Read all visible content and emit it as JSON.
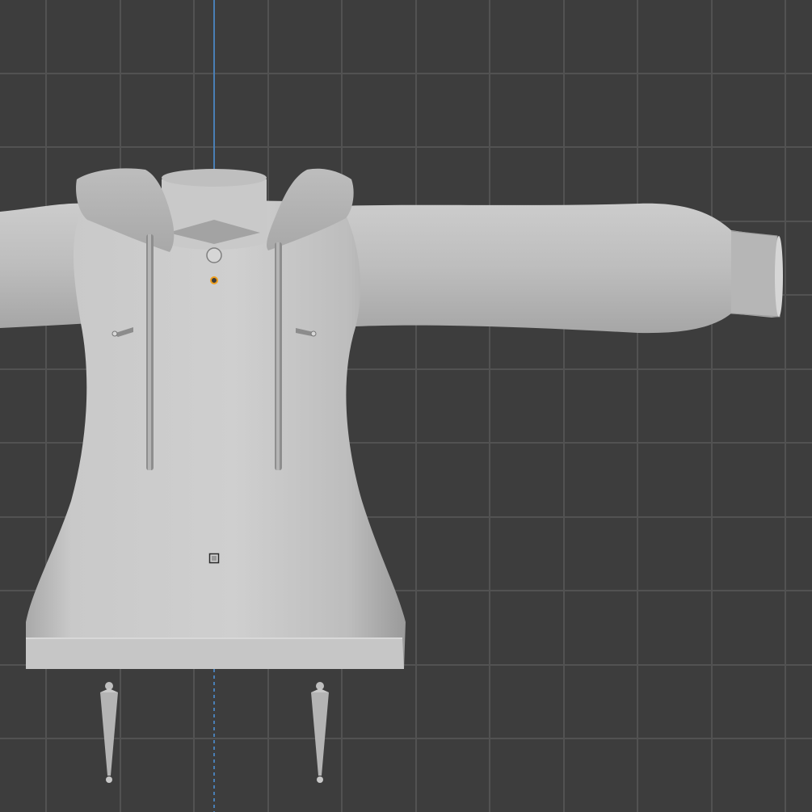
{
  "viewport": {
    "view": "front-orthographic",
    "background_color": "#3d3d3d",
    "grid_color": "#525252",
    "axis_color": "#4a7fb5",
    "mesh_color": "#c4c4c4",
    "active_origin_color": "#f0a020"
  },
  "scene": {
    "mesh": {
      "name": "hoodie-mesh",
      "sleeve": "right",
      "hood": "up"
    },
    "drawstrings": {
      "count": 2
    },
    "bones": {
      "count": 4
    },
    "origins": {
      "count": 3
    }
  }
}
